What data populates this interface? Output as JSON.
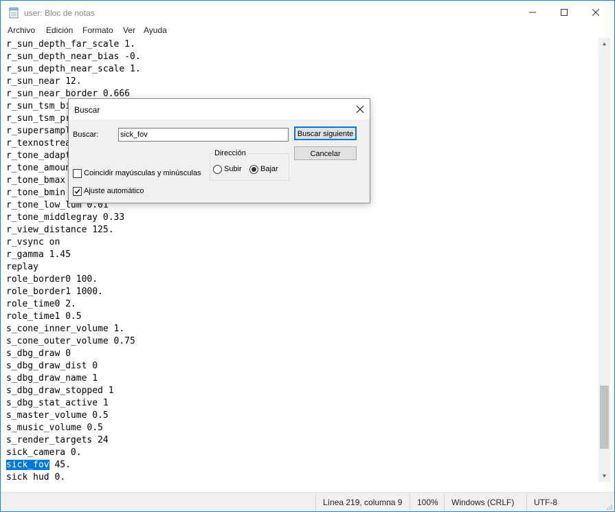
{
  "window": {
    "title": "user: Bloc de notas"
  },
  "menu": [
    "Archivo",
    "Edición",
    "Formato",
    "Ver",
    "Ayuda"
  ],
  "editor": {
    "lines": [
      "r_sun_depth_far_scale 1.",
      "r_sun_depth_near_bias -0.",
      "r_sun_depth_near_scale 1.",
      "r_sun_near 12.",
      "r_sun_near_border 0.666",
      "r_sun_tsm_bi",
      "r_sun_tsm_pr",
      "r_supersampl",
      "r_texnostrea",
      "r_tone_adapt",
      "r_tone_amoun",
      "r_tone_bmax",
      "r_tone_bmin",
      "r_tone_low_lum 0.01",
      "r_tone_middlegray 0.33",
      "r_view_distance 125.",
      "r_vsync on",
      "r_gamma 1.45",
      "replay",
      "role_border0 100.",
      "role_border1 1000.",
      "role_time0 2.",
      "role_time1 0.5",
      "s_cone_inner_volume 1.",
      "s_cone_outer_volume 0.75",
      "s_dbg_draw 0",
      "s_dbg_draw_dist 0",
      "s_dbg_draw_name 1",
      "s_dbg_draw_stopped 1",
      "s_dbg_stat_active 1",
      "s_master_volume 0.5",
      "s_music_volume 0.5",
      "s_render_targets 24",
      "sick_camera 0."
    ],
    "selected_text": "sick_fov",
    "selected_rest": " 45.",
    "last_line": "sick hud 0."
  },
  "status": {
    "position": "Línea 219, columna 9",
    "zoom": "100%",
    "line_ending": "Windows (CRLF)",
    "encoding": "UTF-8"
  },
  "find_dialog": {
    "title": "Buscar",
    "label": "Buscar:",
    "value": "sick_fov",
    "find_next": "Buscar siguiente",
    "cancel": "Cancelar",
    "direction_title": "Dirección",
    "up": "Subir",
    "down": "Bajar",
    "direction_selected": "Bajar",
    "match_case": "Coincidir mayúsculas y minúsculas",
    "match_case_checked": false,
    "wrap": "Ajuste automático",
    "wrap_checked": true
  },
  "colors": {
    "accent": "#0078d7",
    "window_border": "#1883d7",
    "selection_text": "#ffffff"
  }
}
